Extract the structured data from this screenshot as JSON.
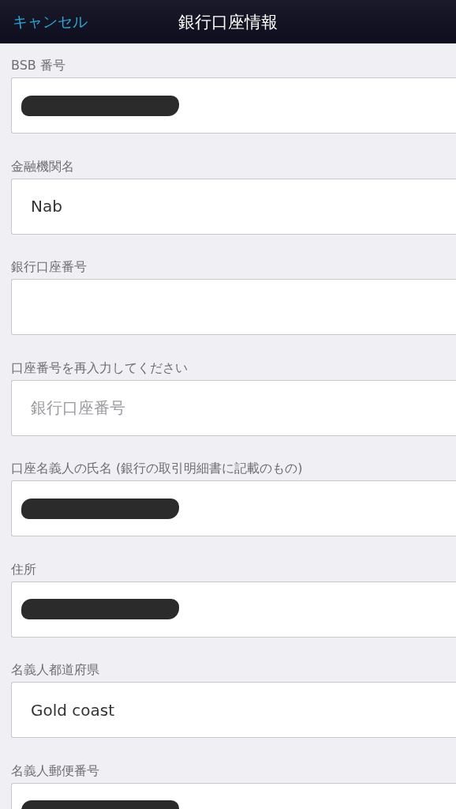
{
  "nav_bar": {
    "cancel": "キャンセル",
    "title": "銀行口座情報"
  },
  "fields": [
    {
      "label": "BSB 番号",
      "redacted": true
    },
    {
      "label": "金融機関名",
      "value": "Nab"
    },
    {
      "label": "銀行口座番号"
    },
    {
      "label": "口座番号を再入力してください",
      "placeholder": "銀行口座番号"
    },
    {
      "label": "口座名義人の氏名 (銀行の取引明細書に記載のもの)",
      "redacted": true
    },
    {
      "label": "住所",
      "redacted": true
    },
    {
      "label": "名義人都道府県",
      "value": "Gold coast"
    },
    {
      "label": "名義人郵便番号",
      "redacted": true
    }
  ]
}
